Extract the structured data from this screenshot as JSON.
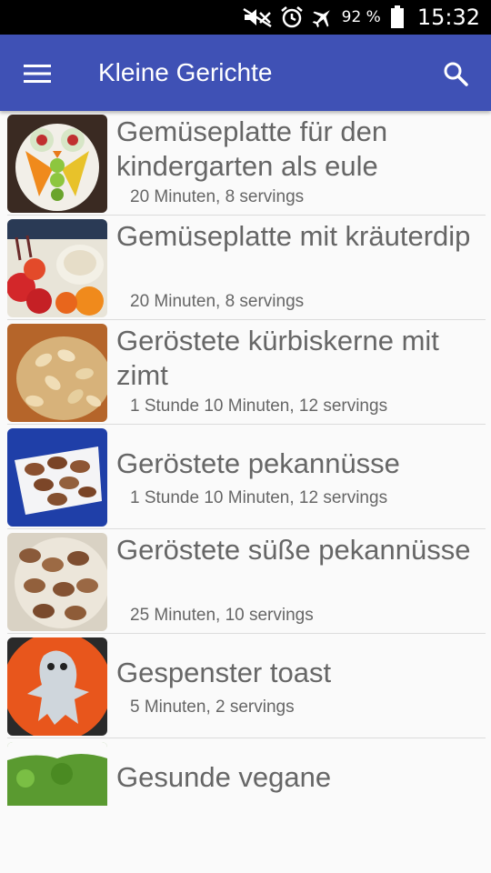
{
  "status_bar": {
    "icons": [
      "mute-icon",
      "alarm-icon",
      "airplane-mode-icon",
      "battery-icon"
    ],
    "battery_percent": "92 %",
    "time": "15:32"
  },
  "app_bar": {
    "title": "Kleine Gerichte",
    "menu_icon": "hamburger-menu-icon",
    "search_icon": "search-icon"
  },
  "recipes": [
    {
      "title": "",
      "meta": ""
    },
    {
      "title": "Gemüseplatte für den kindergarten als eule",
      "meta": "20 Minuten, 8 servings",
      "thumb_color": "#c8692c"
    },
    {
      "title": "Gemüseplatte mit kräuterdip",
      "meta": "20 Minuten, 8 servings",
      "thumb_color": "#d9412b"
    },
    {
      "title": "Geröstete kürbiskerne mit zimt",
      "meta": "1 Stunde 10 Minuten, 12 servings",
      "thumb_color": "#c58b3d"
    },
    {
      "title": "Geröstete pekannüsse",
      "meta": "1 Stunde 10 Minuten, 12 servings",
      "thumb_color": "#1f3fa8"
    },
    {
      "title": "Geröstete süße pekannüsse",
      "meta": "25 Minuten, 10 servings",
      "thumb_color": "#8a5a3a"
    },
    {
      "title": "Gespenster toast",
      "meta": "5 Minuten, 2 servings",
      "thumb_color": "#e8561c"
    },
    {
      "title": "Gesunde vegane",
      "meta": "",
      "thumb_color": "#5a9a30"
    }
  ],
  "colors": {
    "app_bar": "#3f51b5",
    "status_bar": "#000000",
    "text": "#666666"
  }
}
